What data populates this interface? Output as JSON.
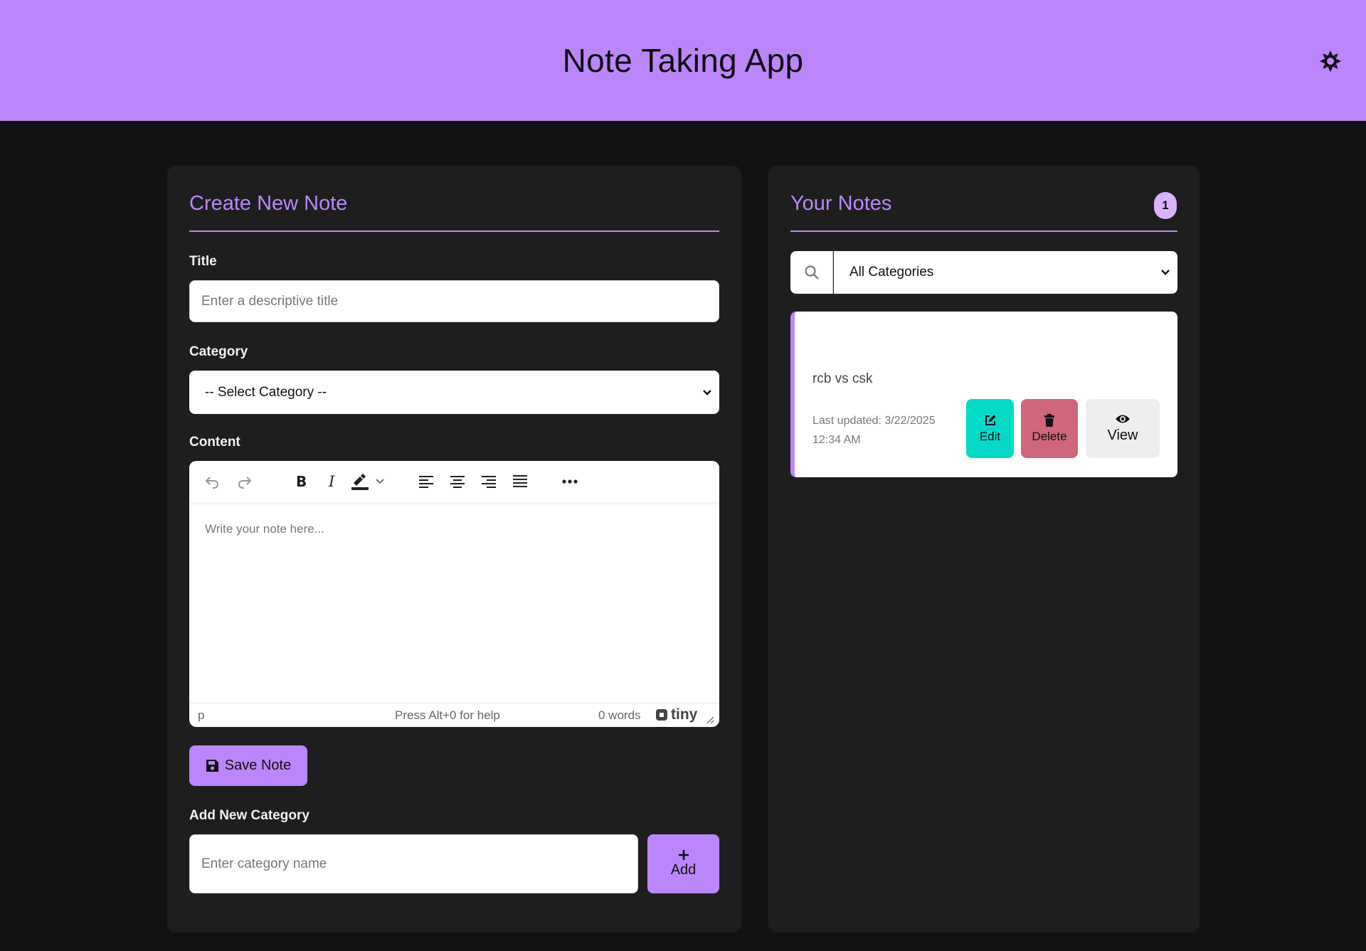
{
  "header": {
    "title": "Note Taking App",
    "theme_icon": "sun-icon"
  },
  "create": {
    "title": "Create New Note",
    "title_label": "Title",
    "title_placeholder": "Enter a descriptive title",
    "category_label": "Category",
    "category_selected": "-- Select Category --",
    "content_label": "Content",
    "editor_placeholder": "Write your note here...",
    "status_path": "p",
    "status_help": "Press Alt+0 for help",
    "status_words": "0 words",
    "brand": "tiny",
    "save_label": "Save Note",
    "add_category_label": "Add New Category",
    "category_name_placeholder": "Enter category name",
    "add_label": "Add"
  },
  "notes": {
    "title": "Your Notes",
    "count": "1",
    "filter_selected": "All Categories",
    "items": [
      {
        "title": "rcb vs csk",
        "updated": "Last updated: 3/22/2025 12:34 AM",
        "edit_label": "Edit",
        "delete_label": "Delete",
        "view_label": "View"
      }
    ]
  },
  "colors": {
    "accent": "#bb86fc",
    "background": "#121212",
    "surface": "#1e1e1e",
    "edit": "#03dac6",
    "delete": "#cf6679",
    "view": "#eeeeee"
  }
}
